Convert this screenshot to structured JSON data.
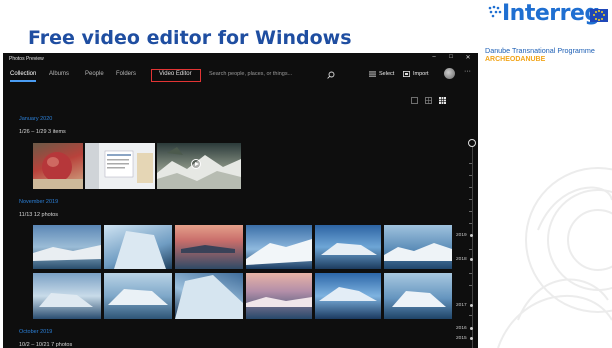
{
  "slide": {
    "title": "Free video editor for Windows"
  },
  "logo": {
    "brand": "Interreg",
    "programme": "Danube Transnational Programme",
    "project": "ARCHEODANUBE"
  },
  "app": {
    "name": "Photos Preview",
    "window_controls": {
      "minimize": "–",
      "maximize": "□",
      "close": "✕"
    },
    "tabs": [
      {
        "label": "Collection",
        "active": true
      },
      {
        "label": "Albums",
        "active": false
      },
      {
        "label": "People",
        "active": false
      },
      {
        "label": "Folders",
        "active": false
      },
      {
        "label": "Video Editor",
        "active": false,
        "highlighted": true
      }
    ],
    "search": {
      "placeholder": "Search people, places, or things..."
    },
    "toolbar": {
      "select_label": "Select",
      "import_label": "Import",
      "more_label": "···"
    },
    "sections": [
      {
        "heading": "January 2020",
        "subheading": "1/26 – 1/29  3 items"
      },
      {
        "heading": "November 2019",
        "subheading": "11/13  12 photos"
      },
      {
        "heading": "October 2019",
        "subheading": "10/2 – 10/21  7 photos"
      }
    ],
    "timeline": {
      "years": [
        "2019",
        "2018",
        "2017",
        "2016",
        "2015"
      ]
    }
  },
  "colors": {
    "title_blue": "#1f4ea1",
    "accent_blue": "#2b7fd6",
    "highlight_red": "#e23434",
    "app_background": "#0e0e0e"
  }
}
